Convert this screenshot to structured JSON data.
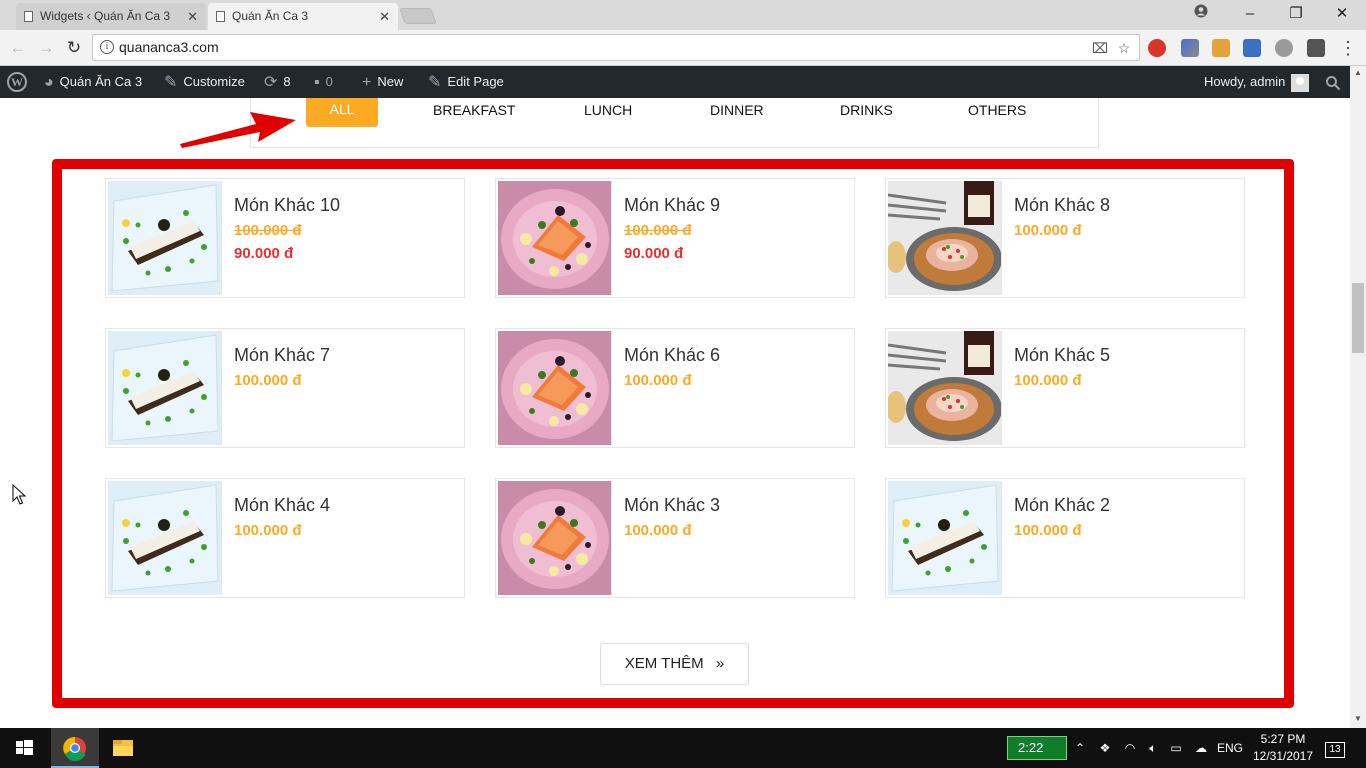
{
  "browser": {
    "tabs": [
      {
        "label": "Widgets ‹ Quán Ăn Ca 3"
      },
      {
        "label": "Quán Ăn Ca 3"
      }
    ],
    "url": "quananca3.com"
  },
  "adminbar": {
    "site_name": "Quán Ăn Ca 3",
    "customize": "Customize",
    "updates_count": "8",
    "comments_count": "0",
    "new_label": "New",
    "edit_page": "Edit Page",
    "howdy": "Howdy, admin"
  },
  "filters": [
    "ALL",
    "BREAKFAST",
    "LUNCH",
    "DINNER",
    "DRINKS",
    "OTHERS"
  ],
  "products": [
    {
      "name": "Món Khác 10",
      "price": "100.000 đ",
      "sale": "90.000 đ",
      "image": "fish-plate"
    },
    {
      "name": "Món Khác 9",
      "price": "100.000 đ",
      "sale": "90.000 đ",
      "image": "salmon-pink-plate"
    },
    {
      "name": "Món Khác 8",
      "price": "100.000 đ",
      "image": "meat-wine"
    },
    {
      "name": "Món Khác 7",
      "price": "100.000 đ",
      "image": "fish-plate"
    },
    {
      "name": "Món Khác 6",
      "price": "100.000 đ",
      "image": "salmon-pink-plate"
    },
    {
      "name": "Món Khác 5",
      "price": "100.000 đ",
      "image": "meat-wine"
    },
    {
      "name": "Món Khác 4",
      "price": "100.000 đ",
      "image": "fish-plate"
    },
    {
      "name": "Món Khác 3",
      "price": "100.000 đ",
      "image": "salmon-pink-plate"
    },
    {
      "name": "Món Khác 2",
      "price": "100.000 đ",
      "image": "fish-plate"
    }
  ],
  "more_button": {
    "label": "XEM THÊM",
    "icon": "»"
  },
  "taskbar": {
    "battery_time": "2:22",
    "language": "ENG",
    "time": "5:27 PM",
    "date": "12/31/2017",
    "notifications": "13"
  },
  "colors": {
    "accent": "#fca924",
    "sale": "#e8312f",
    "highlight": "#e00000",
    "adminbar": "#23282d"
  }
}
